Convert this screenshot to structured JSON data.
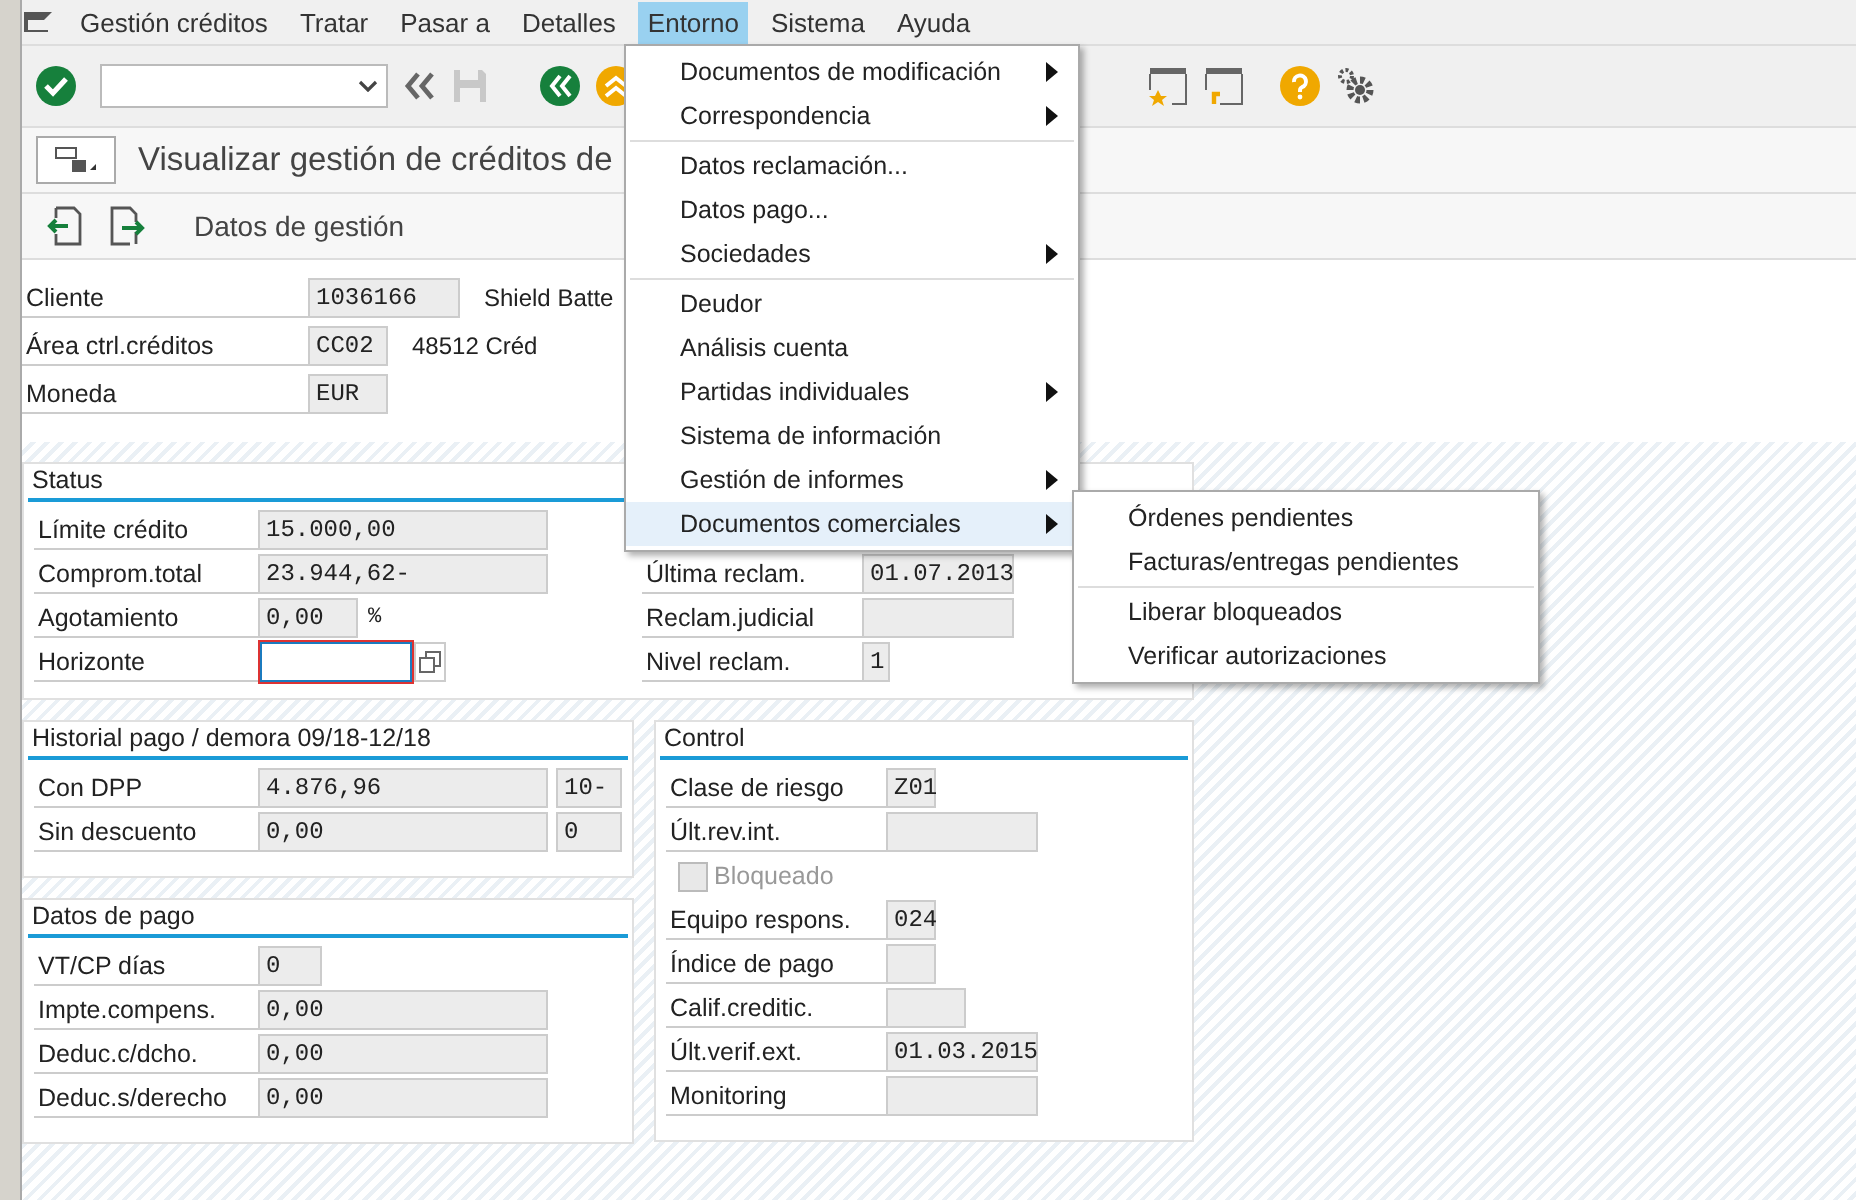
{
  "menu_bar": [
    {
      "label": "Gestión créditos",
      "selected": false
    },
    {
      "label": "Tratar",
      "selected": false
    },
    {
      "label": "Pasar a",
      "selected": false
    },
    {
      "label": "Detalles",
      "selected": false
    },
    {
      "label": "Entorno",
      "selected": true
    },
    {
      "label": "Sistema",
      "selected": false
    },
    {
      "label": "Ayuda",
      "selected": false
    }
  ],
  "title": "Visualizar gestión de créditos de",
  "app_toolbar": {
    "button": "Datos de gestión"
  },
  "header_fields": [
    {
      "label": "Cliente",
      "value": "1036166",
      "note": "Shield Batte"
    },
    {
      "label": "Área ctrl.créditos",
      "value": "CC02",
      "note": "48512 Créd"
    },
    {
      "label": "Moneda",
      "value": "EUR"
    }
  ],
  "status": {
    "title": "Status",
    "left": [
      {
        "kind": "field",
        "label": "Límite crédito",
        "value": "15.000,00"
      },
      {
        "kind": "field",
        "label": "Comprom.total",
        "value": "23.944,62-"
      },
      {
        "kind": "field",
        "label": "Agotamiento",
        "value": "0,00",
        "unit": "%"
      },
      {
        "kind": "input",
        "label": "Horizonte"
      }
    ],
    "right": [
      {
        "kind": "field",
        "label": "Última reclam.",
        "value": "01.07.2013"
      },
      {
        "kind": "field",
        "label": "Reclam.judicial"
      },
      {
        "kind": "field",
        "label": "Nivel reclam.",
        "value": "1"
      }
    ]
  },
  "payment_history": {
    "title": "Historial pago / demora 09/18-12/18",
    "rows": [
      {
        "kind": "field",
        "label": "Con DPP",
        "value": "4.876,96",
        "extra": "10-"
      },
      {
        "kind": "field",
        "label": "Sin descuento",
        "value": "0,00",
        "extra": "0"
      }
    ]
  },
  "payment_data": {
    "title": "Datos de pago",
    "rows": [
      {
        "kind": "field",
        "label": "VT/CP días",
        "value": "0"
      },
      {
        "kind": "field",
        "label": "Impte.compens.",
        "value": "0,00"
      },
      {
        "kind": "field",
        "label": "Deduc.c/dcho.",
        "value": "0,00"
      },
      {
        "kind": "field",
        "label": "Deduc.s/derecho",
        "value": "0,00"
      }
    ]
  },
  "control": {
    "title": "Control",
    "rows": [
      {
        "kind": "field",
        "label": "Clase de riesgo",
        "value": "Z01"
      },
      {
        "kind": "field",
        "label": "Últ.rev.int."
      },
      {
        "kind": "checkbox",
        "label": "Bloqueado",
        "checked": false,
        "disabled": true
      },
      {
        "kind": "field",
        "label": "Equipo respons.",
        "value": "024"
      },
      {
        "kind": "field",
        "label": "Índice de pago"
      },
      {
        "kind": "field",
        "label": "Calif.creditic."
      },
      {
        "kind": "field",
        "label": "Últ.verif.ext.",
        "value": "01.03.2015"
      },
      {
        "kind": "field",
        "label": "Monitoring"
      }
    ]
  },
  "menu": {
    "sections": [
      [
        {
          "label": "Documentos de modificación",
          "submenu": true,
          "selected": false
        },
        {
          "label": "Correspondencia",
          "submenu": true,
          "selected": false
        }
      ],
      [
        {
          "label": "Datos reclamación...",
          "submenu": false,
          "selected": false
        },
        {
          "label": "Datos pago...",
          "submenu": false,
          "selected": false
        },
        {
          "label": "Sociedades",
          "submenu": true,
          "selected": false
        }
      ],
      [
        {
          "label": "Deudor",
          "submenu": false,
          "selected": false
        },
        {
          "label": "Análisis cuenta",
          "submenu": false,
          "selected": false
        },
        {
          "label": "Partidas individuales",
          "submenu": true,
          "selected": false
        },
        {
          "label": "Sistema de información",
          "submenu": false,
          "selected": false
        },
        {
          "label": "Gestión de informes",
          "submenu": true,
          "selected": false
        },
        {
          "label": "Documentos comerciales",
          "submenu": true,
          "selected": true
        }
      ]
    ]
  },
  "submenu": {
    "sections": [
      [
        {
          "label": "Órdenes pendientes",
          "submenu": false,
          "selected": false
        },
        {
          "label": "Facturas/entregas pendientes",
          "submenu": false,
          "selected": false
        }
      ],
      [
        {
          "label": "Liberar bloqueados",
          "submenu": false,
          "selected": false
        },
        {
          "label": "Verificar autorizaciones",
          "submenu": false,
          "selected": false
        }
      ]
    ]
  }
}
